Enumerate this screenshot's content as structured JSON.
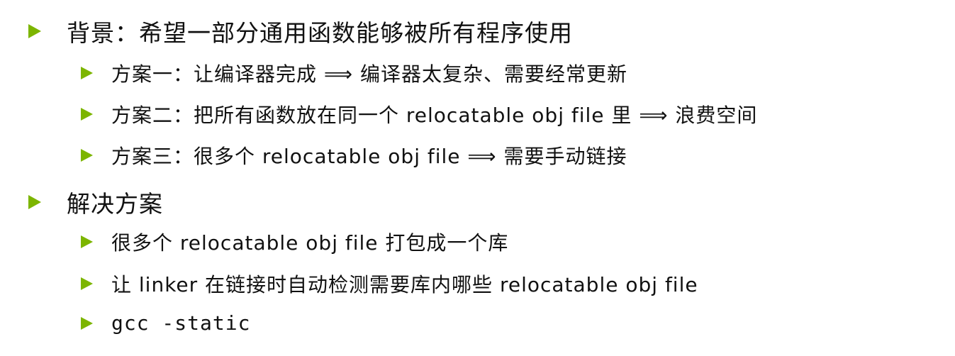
{
  "bullets": [
    {
      "text": "背景：希望一部分通用函数能够被所有程序使用",
      "sub": [
        "方案一：让编译器完成 ⟹ 编译器太复杂、需要经常更新",
        "方案二：把所有函数放在同一个 relocatable obj file 里 ⟹ 浪费空间",
        "方案三：很多个 relocatable obj file ⟹ 需要手动链接"
      ]
    },
    {
      "text": "解决方案",
      "sub": [
        "很多个 relocatable obj file 打包成一个库",
        "让 linker 在链接时自动检测需要库内哪些 relocatable obj file",
        "gcc -static"
      ]
    }
  ],
  "colors": {
    "bullet": "#7cb500",
    "text": "#111111",
    "background": "#ffffff"
  },
  "icons": {
    "bullet": "triangle-bullet-icon"
  }
}
